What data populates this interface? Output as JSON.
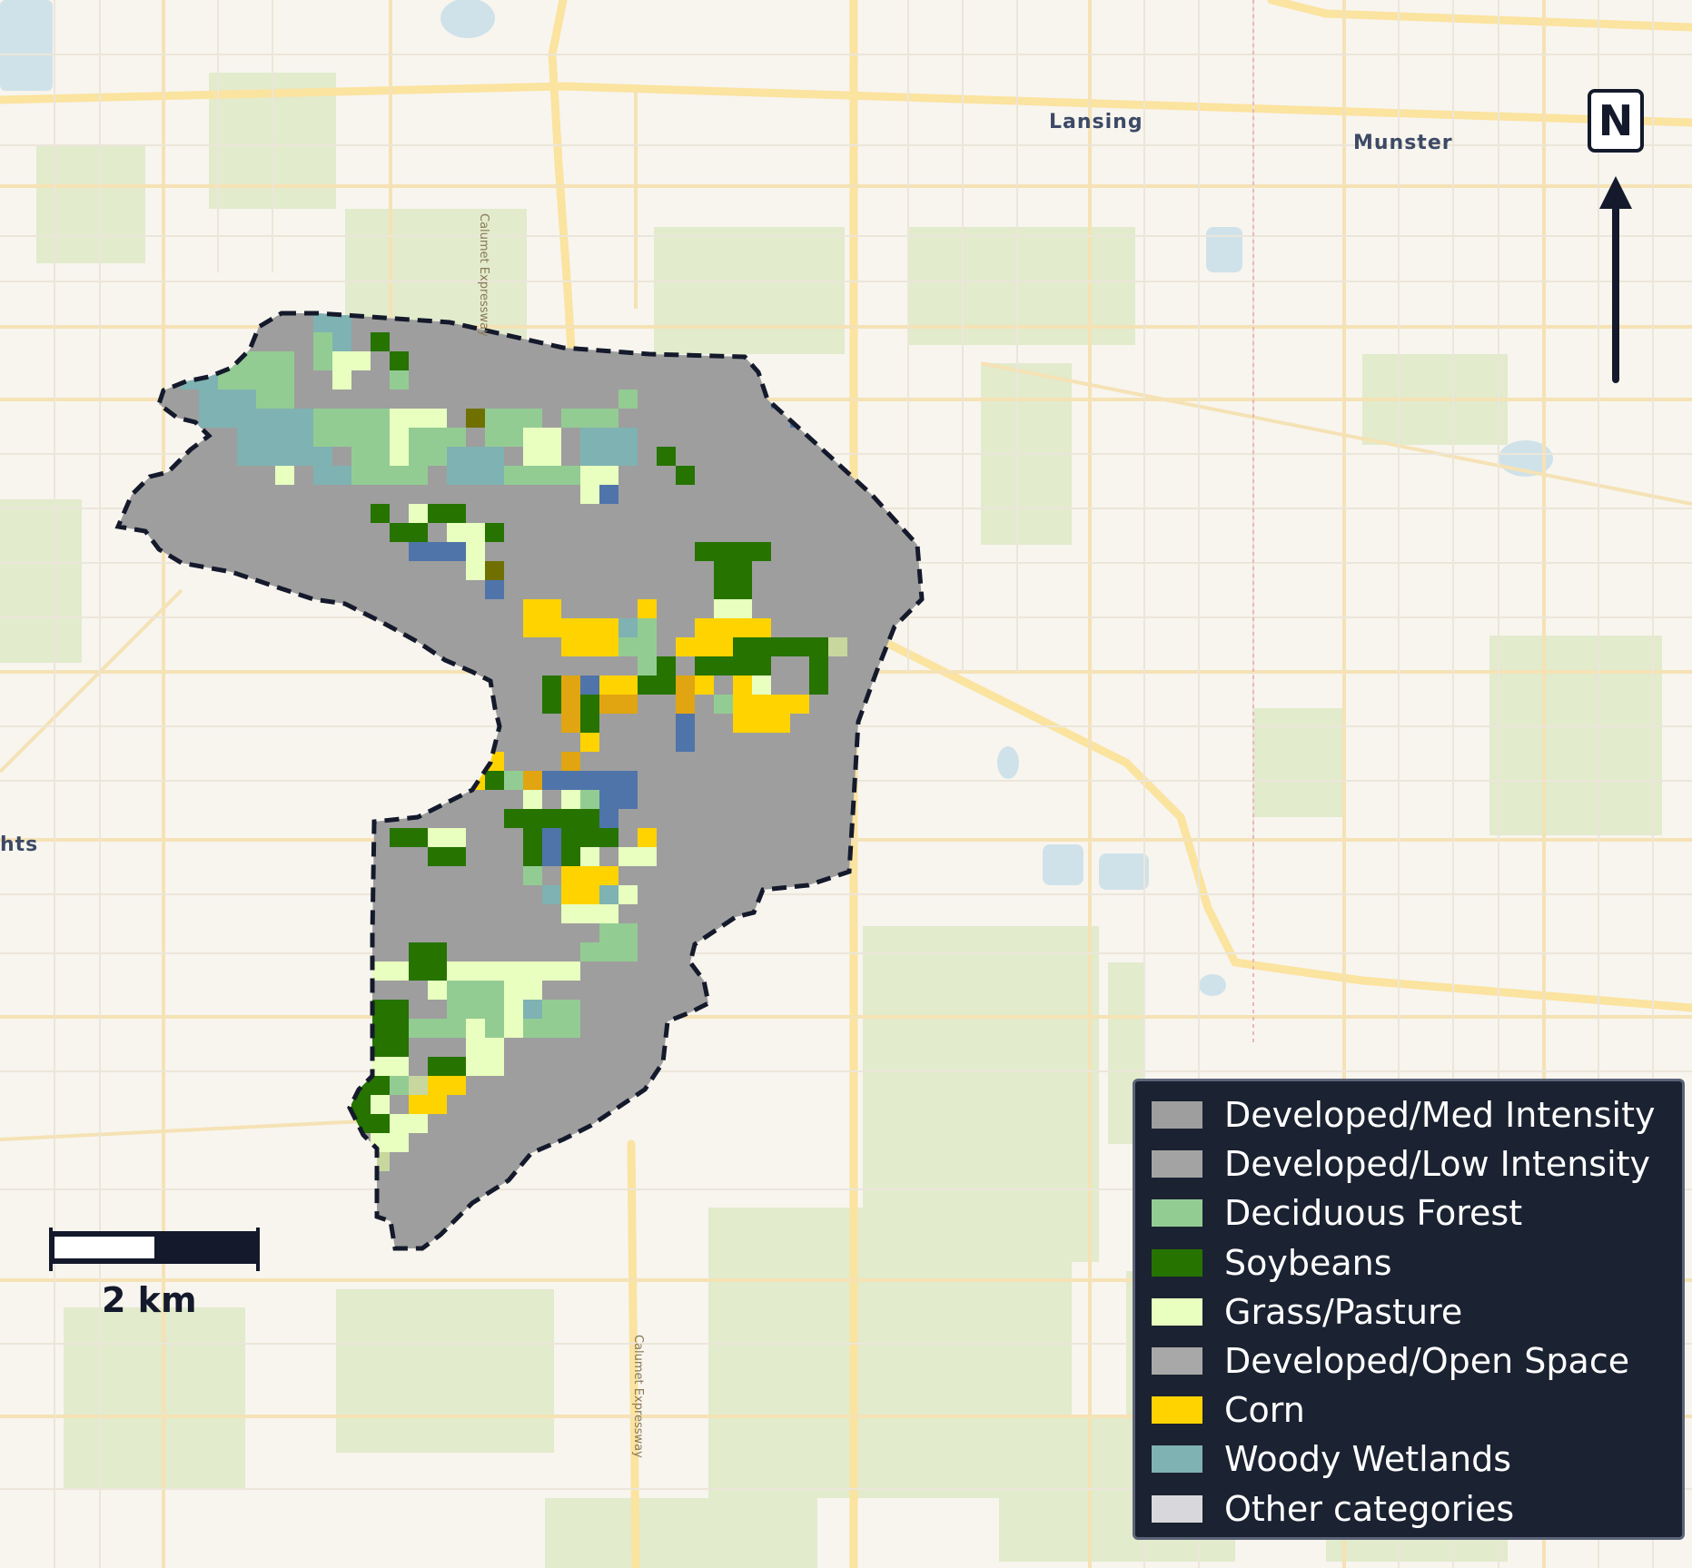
{
  "map": {
    "places": [
      {
        "name": "Lansing"
      },
      {
        "name": "Munster"
      },
      {
        "name": "hts"
      }
    ],
    "roads": [
      {
        "name": "Calumet Expressway"
      },
      {
        "name": "Calumet Expressway"
      }
    ],
    "north_arrow": {
      "label": "N"
    },
    "scale_bar": {
      "label": "2 km"
    },
    "colors": {
      "developed": "#9e9e9e",
      "deciduous": "#93cc93",
      "soybeans": "#267300",
      "grass": "#e8ffbf",
      "corn": "#ffd300",
      "corn_dark": "#e0a510",
      "wetlands": "#7fb2b2",
      "water": "#4f74aa",
      "mixed": "#c7d79e",
      "olive": "#707000",
      "boundary": "#141a2b"
    }
  },
  "legend": {
    "items": [
      {
        "label": "Developed/Med Intensity",
        "color": "#9e9e9e"
      },
      {
        "label": "Developed/Low Intensity",
        "color": "#a3a3a3"
      },
      {
        "label": "Deciduous Forest",
        "color": "#93cc93"
      },
      {
        "label": "Soybeans",
        "color": "#267300"
      },
      {
        "label": "Grass/Pasture",
        "color": "#e8ffbf"
      },
      {
        "label": "Developed/Open Space",
        "color": "#a8a8a8"
      },
      {
        "label": "Corn",
        "color": "#ffd300"
      },
      {
        "label": "Woody Wetlands",
        "color": "#7fb2b2"
      },
      {
        "label": "Other categories",
        "color": "#d8d8dc"
      }
    ]
  }
}
